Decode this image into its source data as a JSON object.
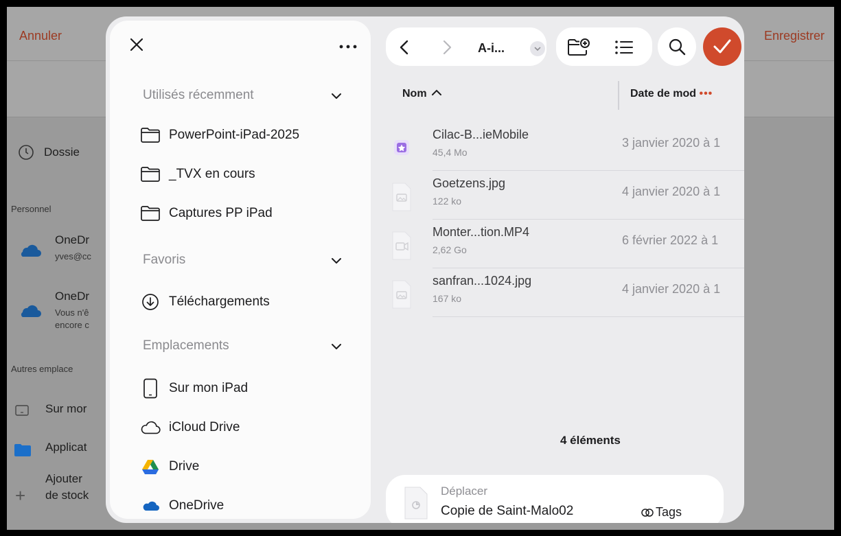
{
  "background": {
    "cancel_label": "Annuler",
    "save_label": "Enregistrer",
    "recent_label": "Dossie",
    "personal_section": "Personnel",
    "onedrive1_name": "OneDr",
    "onedrive1_email": "yves@cc",
    "onedrive2_name": "OneDr",
    "onedrive2_line1": "Vous n'ê",
    "onedrive2_line2": "encore c",
    "other_section": "Autres emplace",
    "on_my": "Sur mor",
    "applications": "Applicat",
    "add_line1": "Ajouter",
    "add_line2": "de stock"
  },
  "sidebar": {
    "recent": {
      "title": "Utilisés récemment",
      "items": [
        "PowerPoint-iPad-2025",
        "_TVX en cours",
        "Captures PP iPad"
      ]
    },
    "favorites": {
      "title": "Favoris",
      "items": [
        "Téléchargements"
      ]
    },
    "locations": {
      "title": "Emplacements",
      "items": [
        "Sur mon iPad",
        "iCloud Drive",
        "Drive",
        "OneDrive"
      ]
    }
  },
  "toolbar": {
    "folder_name": "A-i..."
  },
  "columns": {
    "name": "Nom",
    "date": "Date de mod"
  },
  "files": [
    {
      "name": "Cilac-B...ieMobile",
      "size": "45,4 Mo",
      "date": "3 janvier 2020 à 1",
      "kind": "app"
    },
    {
      "name": "Goetzens.jpg",
      "size": "122 ko",
      "date": "4 janvier 2020 à 1",
      "kind": "image"
    },
    {
      "name": "Monter...tion.MP4",
      "size": "2,62 Go",
      "date": "6 février 2022 à 1",
      "kind": "video"
    },
    {
      "name": "sanfran...1024.jpg",
      "size": "167 ko",
      "date": "4 janvier 2020 à 1",
      "kind": "image"
    }
  ],
  "count_label": "4 éléments",
  "bottom": {
    "action": "Déplacer",
    "document": "Copie de Saint-Malo02",
    "tags_label": "Tags"
  },
  "colors": {
    "accent": "#c44a26",
    "brand_red": "#d04a2c"
  }
}
